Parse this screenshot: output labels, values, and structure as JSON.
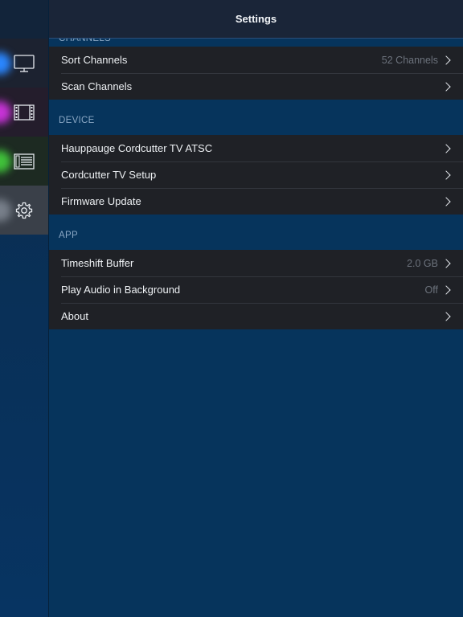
{
  "navbar": {
    "title": "Settings"
  },
  "sidebar": {
    "tabs": [
      {
        "name": "tv-tab",
        "icon": "tv-icon"
      },
      {
        "name": "movies-tab",
        "icon": "film-icon"
      },
      {
        "name": "guide-tab",
        "icon": "guide-icon"
      },
      {
        "name": "settings-tab",
        "icon": "gear-icon",
        "selected": true
      }
    ]
  },
  "sections": {
    "channels": {
      "header": "CHANNELS",
      "rows": [
        {
          "label": "Sort Channels",
          "value": "52 Channels"
        },
        {
          "label": "Scan Channels"
        }
      ]
    },
    "device": {
      "header": "DEVICE",
      "rows": [
        {
          "label": "Hauppauge Cordcutter TV ATSC"
        },
        {
          "label": "Cordcutter TV Setup"
        },
        {
          "label": "Firmware Update"
        }
      ]
    },
    "app": {
      "header": "APP",
      "rows": [
        {
          "label": "Timeshift Buffer",
          "value": "2.0 GB"
        },
        {
          "label": "Play Audio in Background",
          "value": "Off"
        },
        {
          "label": "About"
        }
      ]
    }
  },
  "colors": {
    "background": "#06345c",
    "navbar": "#1a2538",
    "cell": "#1f2126",
    "section_text": "#8aa7c4",
    "tv_accent": "#2a86ff",
    "movies_accent": "#c733d6",
    "guide_accent": "#40c23a"
  }
}
